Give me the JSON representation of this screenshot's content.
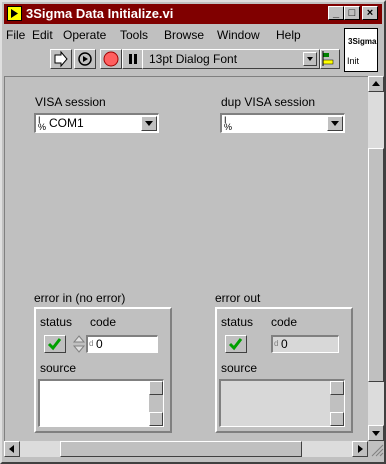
{
  "window": {
    "title": "3Sigma Data Initialize.vi",
    "minimize": "_",
    "maximize": "□",
    "close": "×"
  },
  "menus": [
    {
      "label": "File"
    },
    {
      "label": "Edit"
    },
    {
      "label": "Operate"
    },
    {
      "label": "Tools"
    },
    {
      "label": "Browse"
    },
    {
      "label": "Window"
    },
    {
      "label": "Help"
    }
  ],
  "toolbar": {
    "font": "13pt Dialog Font"
  },
  "vi_icon": {
    "line1": "3Sigma",
    "line2": "Init"
  },
  "visa": {
    "label": "VISA session",
    "value": "COM1"
  },
  "dup_visa": {
    "label": "dup VISA session",
    "value": ""
  },
  "error_in": {
    "label": "error in (no error)",
    "status_label": "status",
    "code_label": "code",
    "code": "0",
    "source_label": "source",
    "source": ""
  },
  "error_out": {
    "label": "error out",
    "status_label": "status",
    "code_label": "code",
    "code": "0",
    "source_label": "source",
    "source": ""
  },
  "icons": {
    "checkmark": "checkmark-icon",
    "visa_ref": "visa-icon"
  },
  "colors": {
    "titlebar": "#800000",
    "face": "#c0c0c0",
    "check_green": "#00a000"
  }
}
